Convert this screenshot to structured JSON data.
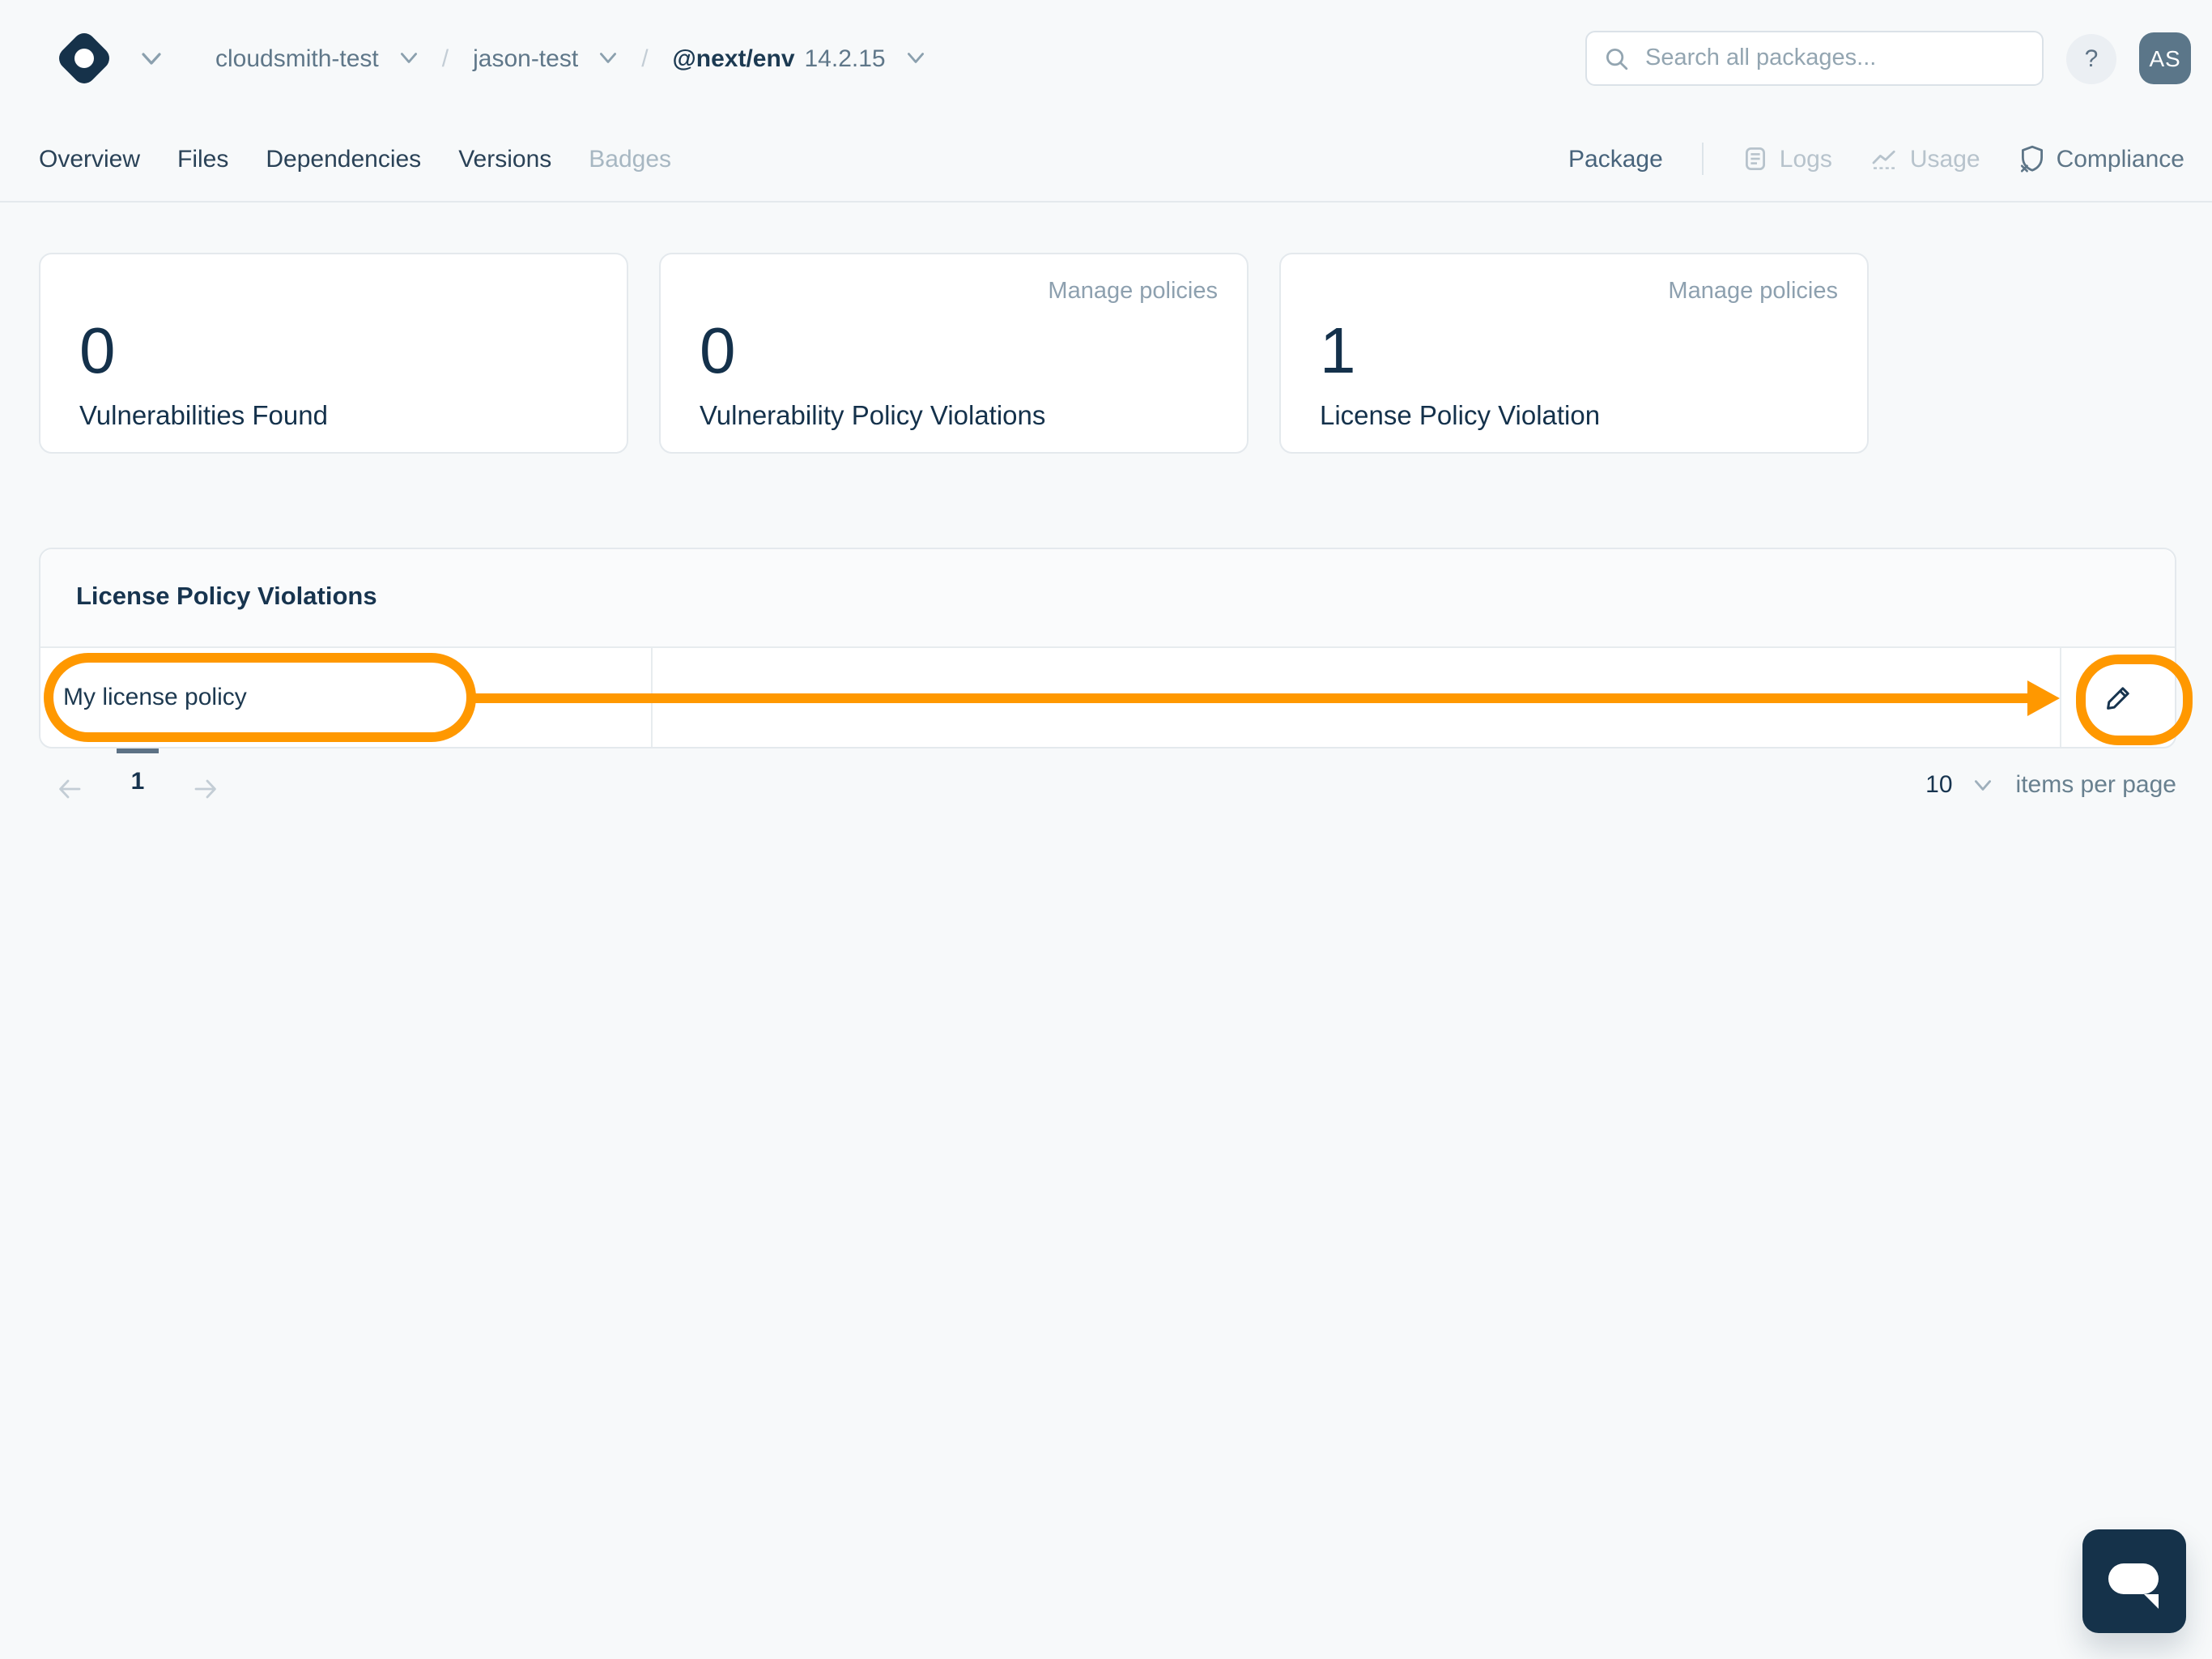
{
  "header": {
    "breadcrumb": {
      "org": "cloudsmith-test",
      "separator": "/",
      "repo": "jason-test",
      "package_name": "@next/env",
      "version": "14.2.15"
    },
    "search_placeholder": "Search all packages...",
    "help_label": "?",
    "avatar_initials": "AS"
  },
  "package_tabs": {
    "items": [
      {
        "label": "Overview"
      },
      {
        "label": "Files"
      },
      {
        "label": "Dependencies"
      },
      {
        "label": "Versions"
      },
      {
        "label": "Badges"
      }
    ]
  },
  "context_nav": {
    "package_label": "Package",
    "logs_label": "Logs",
    "usage_label": "Usage",
    "compliance_label": "Compliance"
  },
  "summary_cards": [
    {
      "value": "0",
      "label": "Vulnerabilities Found",
      "link": ""
    },
    {
      "value": "0",
      "label": "Vulnerability Policy Violations",
      "link": "Manage policies"
    },
    {
      "value": "1",
      "label": "License Policy Violation",
      "link": "Manage policies"
    }
  ],
  "violations_table": {
    "title": "License Policy Violations",
    "rows": [
      {
        "policy_name": "My license policy"
      }
    ]
  },
  "pagination": {
    "page": "1",
    "items_per_page": "10",
    "items_per_page_label": "items per page"
  },
  "icons": {
    "logo": "cloudsmith-diamond",
    "search": "magnifier",
    "logs": "document-lines",
    "usage": "line-chart",
    "compliance": "shield-x",
    "edit": "pencil",
    "chat": "speech-bubble"
  },
  "colors": {
    "annotation_orange": "#ff9800",
    "brand_navy": "#16324a",
    "page_background": "#f7f9fa",
    "avatar_background": "#5b7689"
  }
}
